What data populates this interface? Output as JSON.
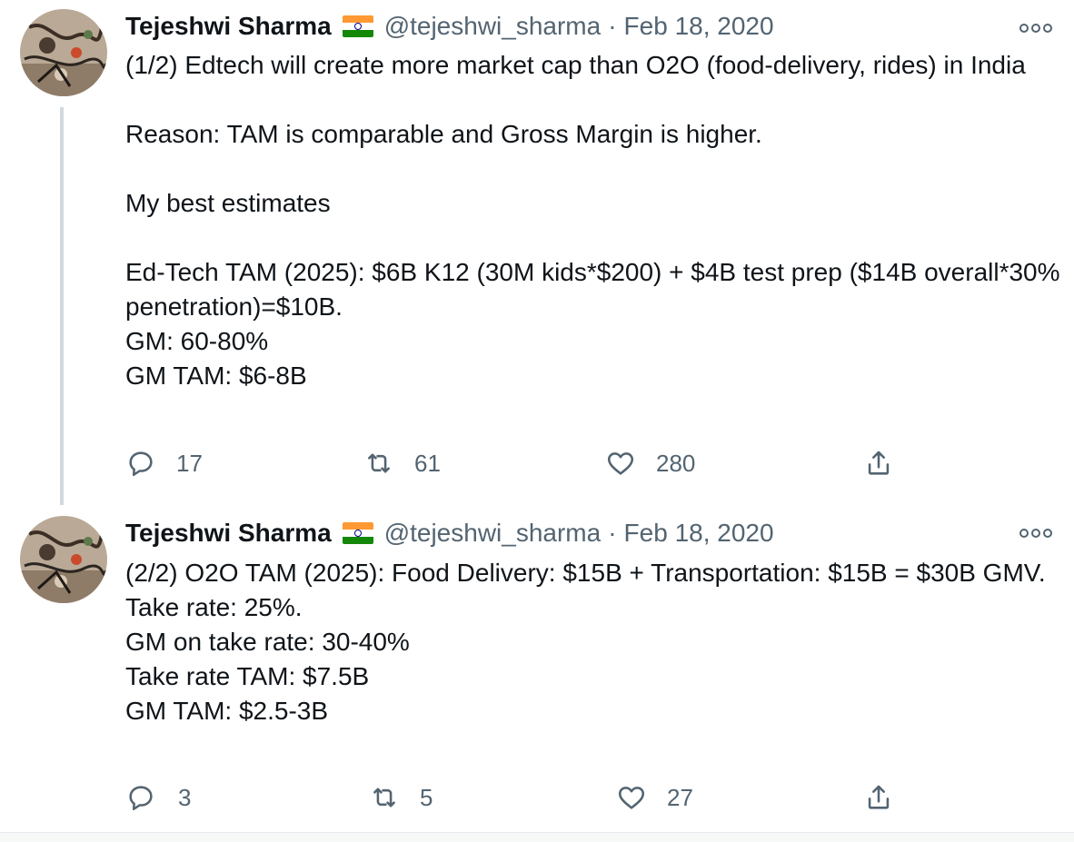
{
  "tweets": [
    {
      "author": "Tejeshwi Sharma",
      "handle": "@tejeshwi_sharma",
      "separator": "·",
      "date": "Feb 18, 2020",
      "flag_icon": "india-flag-icon",
      "lines": [
        "(1/2) Edtech will create more market cap than O2O (food-delivery, rides) in India",
        "",
        "Reason: TAM is comparable and Gross Margin is higher.",
        "",
        "My best estimates",
        "",
        "Ed-Tech TAM (2025): $6B K12 (30M kids*$200) + $4B test prep ($14B overall*30% penetration)=$10B.",
        "GM: 60-80%",
        "GM TAM: $6-8B"
      ],
      "replies": "17",
      "retweets": "61",
      "likes": "280"
    },
    {
      "author": "Tejeshwi Sharma",
      "handle": "@tejeshwi_sharma",
      "separator": "·",
      "date": "Feb 18, 2020",
      "flag_icon": "india-flag-icon",
      "lines": [
        "(2/2) O2O TAM (2025): Food Delivery: $15B + Transportation: $15B = $30B GMV.",
        "Take rate: 25%.",
        "GM on take rate: 30-40%",
        "Take rate TAM: $7.5B",
        "GM TAM: $2.5-3B"
      ],
      "replies": "3",
      "retweets": "5",
      "likes": "27"
    }
  ],
  "colors": {
    "text": "#0f1419",
    "secondary": "#536471",
    "thread_line": "#cfd9de"
  }
}
